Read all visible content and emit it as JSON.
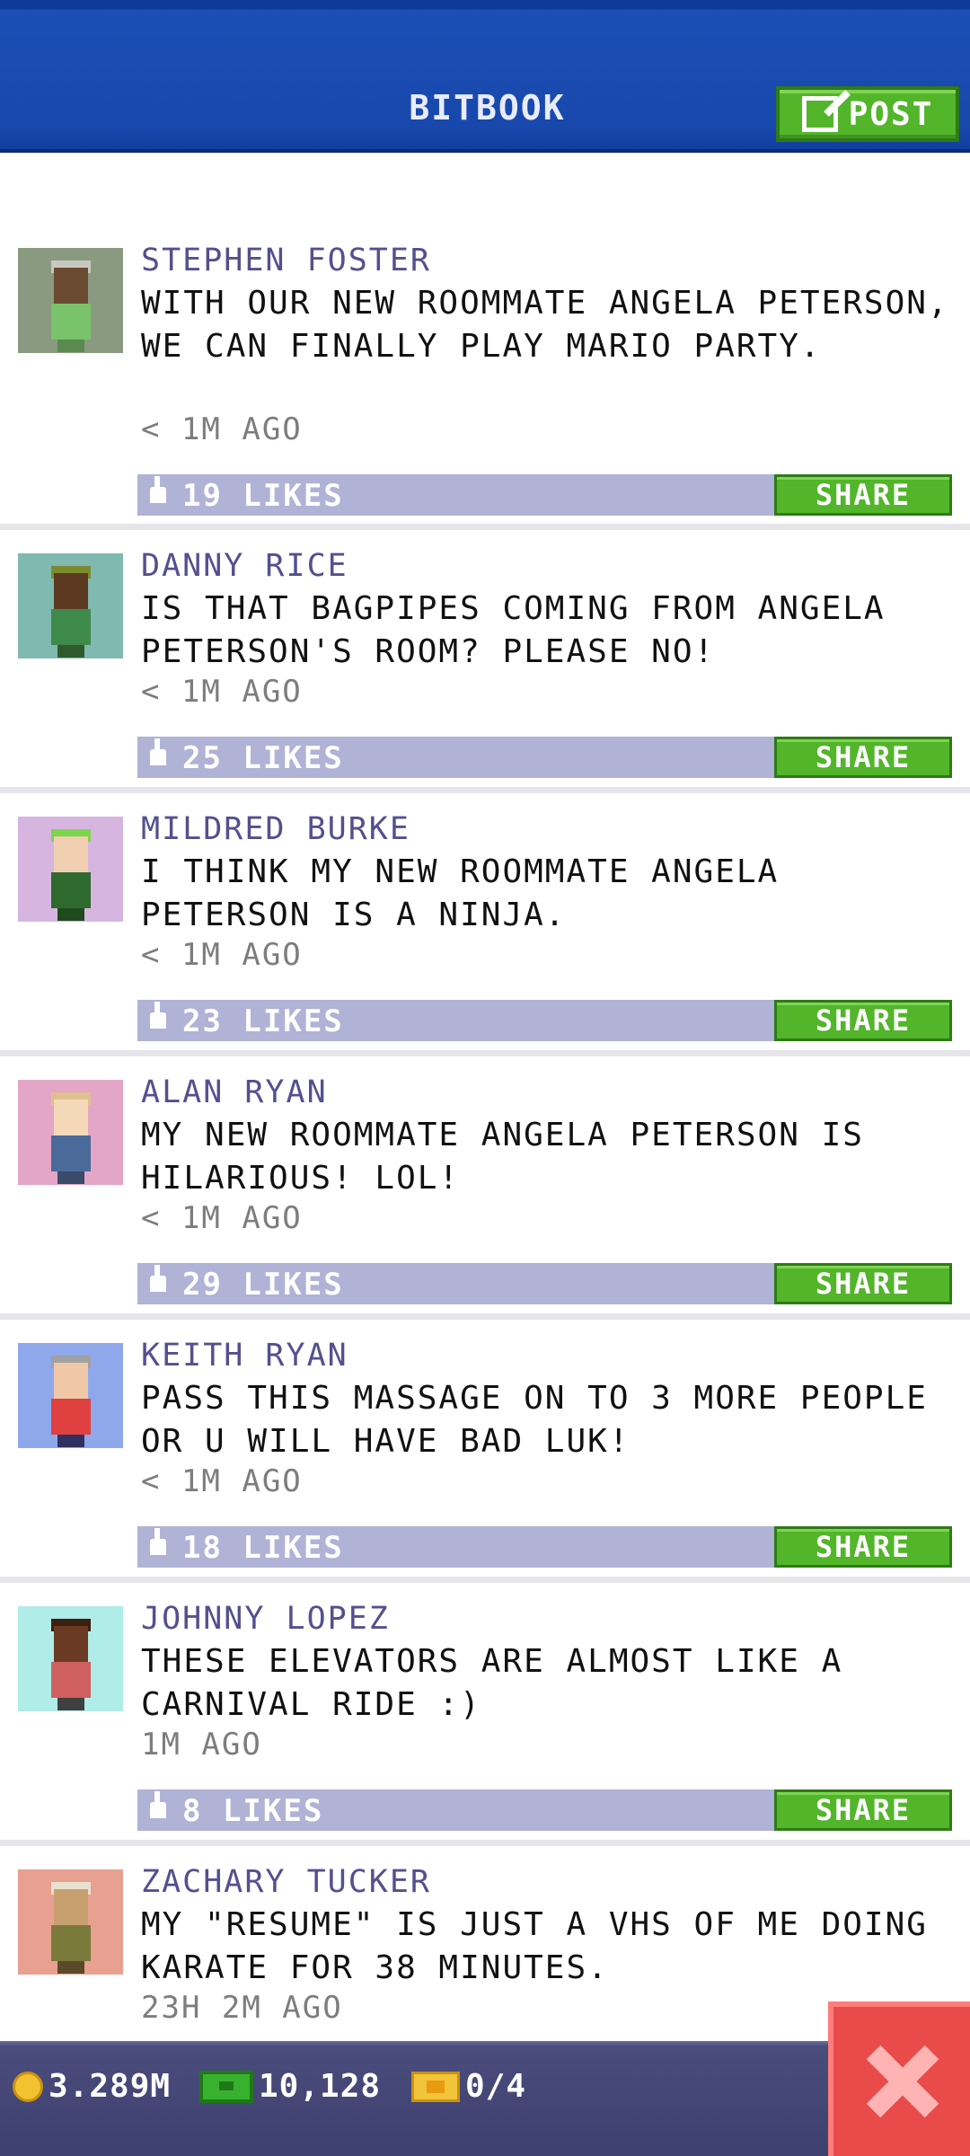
{
  "header": {
    "title": "BITBOOK",
    "post_label": "POST"
  },
  "posts": [
    {
      "name": "STEPHEN FOSTER",
      "text": "WITH OUR NEW ROOMMATE ANGELA PETERSON, WE CAN FINALLY PLAY MARIO PARTY.",
      "time": "< 1M AGO",
      "likes": "19 LIKES",
      "share": "SHARE",
      "avatar_bg": "#8a9a80",
      "skin": "#6a4a30",
      "hair": "#c8c8c0",
      "shirt": "#79c36a",
      "pants": "#5a8a4f"
    },
    {
      "name": "DANNY RICE",
      "text": "IS THAT BAGPIPES COMING FROM ANGELA PETERSON'S ROOM? PLEASE NO!",
      "time": "< 1M AGO",
      "likes": "25 LIKES",
      "share": "SHARE",
      "avatar_bg": "#7fb9b0",
      "skin": "#5c3a22",
      "hair": "#7b8a2e",
      "shirt": "#3e8a4a",
      "pants": "#2e5a2e"
    },
    {
      "name": "MILDRED BURKE",
      "text": "I THINK MY NEW ROOMMATE ANGELA PETERSON IS A NINJA.",
      "time": "< 1M AGO",
      "likes": "23 LIKES",
      "share": "SHARE",
      "avatar_bg": "#d6b6e0",
      "skin": "#f0d0b0",
      "hair": "#7ad64a",
      "shirt": "#2e6a2e",
      "pants": "#1e4a1e"
    },
    {
      "name": "ALAN RYAN",
      "text": "MY NEW ROOMMATE ANGELA PETERSON IS HILARIOUS! LOL!",
      "time": "< 1M AGO",
      "likes": "29 LIKES",
      "share": "SHARE",
      "avatar_bg": "#e3a6c6",
      "skin": "#f5d8b8",
      "hair": "#e0c090",
      "shirt": "#4a6a9a",
      "pants": "#3a4a6a"
    },
    {
      "name": "KEITH RYAN",
      "text": "PASS THIS MASSAGE ON TO 3 MORE PEOPLE OR U WILL HAVE BAD LUK!",
      "time": "< 1M AGO",
      "likes": "18 LIKES",
      "share": "SHARE",
      "avatar_bg": "#8fa8ec",
      "skin": "#f0c8a8",
      "hair": "#a0a0a0",
      "shirt": "#e04040",
      "pants": "#303060"
    },
    {
      "name": "JOHNNY LOPEZ",
      "text": "THESE ELEVATORS ARE ALMOST LIKE A CARNIVAL RIDE :)",
      "time": "1M AGO",
      "likes": "8 LIKES",
      "share": "SHARE",
      "avatar_bg": "#b0ece8",
      "skin": "#6a3a22",
      "hair": "#3a2010",
      "shirt": "#d06060",
      "pants": "#404040"
    },
    {
      "name": "ZACHARY TUCKER",
      "text": "MY \"RESUME\" IS JUST A VHS OF ME DOING KARATE FOR 38 MINUTES.",
      "time": "23H 2M AGO",
      "likes": "",
      "share": "",
      "avatar_bg": "#e8a090",
      "skin": "#c8a070",
      "hair": "#e8e0d0",
      "shirt": "#7a7a3a",
      "pants": "#5a4a2a"
    }
  ],
  "bottom_bar": {
    "coins": "3.289M",
    "bux": "10,128",
    "tickets": "0/4"
  },
  "colors": {
    "header_blue": "#1b4fb5",
    "name_purple": "#54508f",
    "share_green": "#52b52a",
    "likes_bar": "#b0b2d6",
    "close_red": "#e94b4b"
  }
}
